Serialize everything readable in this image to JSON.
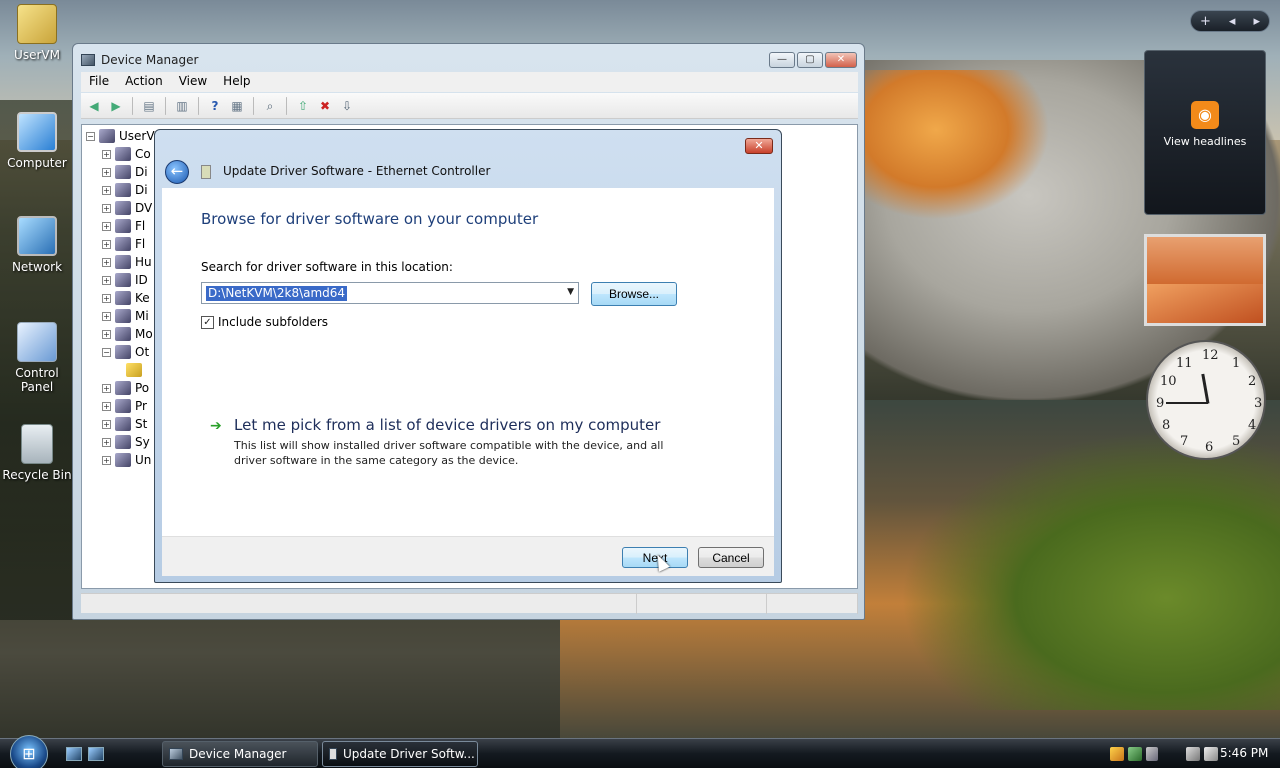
{
  "desktop": {
    "icons": [
      {
        "label": "UserVM"
      },
      {
        "label": "Computer"
      },
      {
        "label": "Network"
      },
      {
        "label": "Control Panel"
      },
      {
        "label": "Recycle Bin"
      }
    ]
  },
  "gadgets": {
    "feed_label": "View headlines",
    "clock_numbers": [
      "12",
      "1",
      "2",
      "3",
      "4",
      "5",
      "6",
      "7",
      "8",
      "9",
      "10",
      "11"
    ],
    "controls": {
      "add": "+",
      "prev": "◂",
      "next": "▸"
    }
  },
  "device_manager": {
    "title": "Device Manager",
    "menu": [
      "File",
      "Action",
      "View",
      "Help"
    ],
    "tree": {
      "root": "UserV",
      "items": [
        "Co",
        "Di",
        "Di",
        "DV",
        "Fl",
        "Fl",
        "Hu",
        "ID",
        "Ke",
        "Mi",
        "Mo",
        "Ot",
        "",
        "Po",
        "Pr",
        "St",
        "Sy",
        "Un"
      ]
    }
  },
  "dialog": {
    "title": "Update Driver Software - Ethernet Controller",
    "heading": "Browse for driver software on your computer",
    "search_label": "Search for driver software in this location:",
    "path_value": "D:\\NetKVM\\2k8\\amd64",
    "browse_label": "Browse...",
    "include_subfolders_label": "Include subfolders",
    "include_subfolders_checked": true,
    "pick_link": "Let me pick from a list of device drivers on my computer",
    "pick_desc": "This list will show installed driver software compatible with the device, and all driver software in the same category as the device.",
    "next_label": "Next",
    "cancel_label": "Cancel"
  },
  "taskbar": {
    "buttons": [
      {
        "label": "Device Manager"
      },
      {
        "label": "Update Driver Softw..."
      }
    ],
    "time": "5:46 PM"
  }
}
